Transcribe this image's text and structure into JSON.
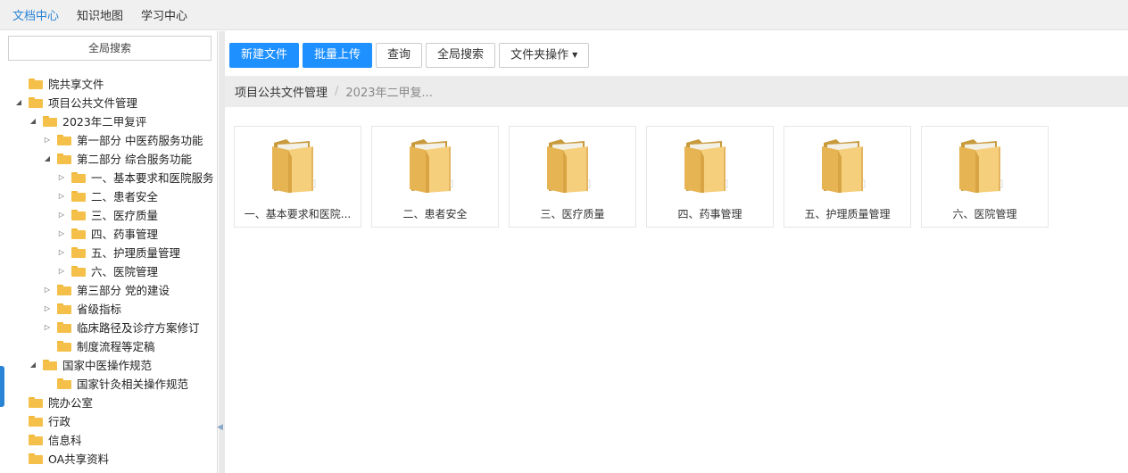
{
  "topnav": {
    "items": [
      {
        "label": "文档中心",
        "active": true
      },
      {
        "label": "知识地图",
        "active": false
      },
      {
        "label": "学习中心",
        "active": false
      }
    ]
  },
  "sidebar": {
    "search_label": "全局搜索",
    "tree": [
      {
        "label": "院共享文件",
        "level": 0,
        "toggle": "none"
      },
      {
        "label": "项目公共文件管理",
        "level": 0,
        "toggle": "open"
      },
      {
        "label": "2023年二甲复评",
        "level": 1,
        "toggle": "open"
      },
      {
        "label": "第一部分 中医药服务功能",
        "level": 2,
        "toggle": "closed"
      },
      {
        "label": "第二部分 综合服务功能",
        "level": 2,
        "toggle": "open"
      },
      {
        "label": "一、基本要求和医院服务",
        "level": 3,
        "toggle": "closed"
      },
      {
        "label": "二、患者安全",
        "level": 3,
        "toggle": "closed"
      },
      {
        "label": "三、医疗质量",
        "level": 3,
        "toggle": "closed"
      },
      {
        "label": "四、药事管理",
        "level": 3,
        "toggle": "closed"
      },
      {
        "label": "五、护理质量管理",
        "level": 3,
        "toggle": "closed"
      },
      {
        "label": "六、医院管理",
        "level": 3,
        "toggle": "closed"
      },
      {
        "label": "第三部分 党的建设",
        "level": 2,
        "toggle": "closed"
      },
      {
        "label": "省级指标",
        "level": 2,
        "toggle": "closed"
      },
      {
        "label": "临床路径及诊疗方案修订",
        "level": 2,
        "toggle": "closed"
      },
      {
        "label": "制度流程等定稿",
        "level": 2,
        "toggle": "none"
      },
      {
        "label": "国家中医操作规范",
        "level": 1,
        "toggle": "open"
      },
      {
        "label": "国家针灸相关操作规范",
        "level": 2,
        "toggle": "none"
      },
      {
        "label": "院办公室",
        "level": 0,
        "toggle": "none"
      },
      {
        "label": "行政",
        "level": 0,
        "toggle": "none"
      },
      {
        "label": "信息科",
        "level": 0,
        "toggle": "none"
      },
      {
        "label": "OA共享资料",
        "level": 0,
        "toggle": "none"
      }
    ]
  },
  "toolbar": {
    "new_file": "新建文件",
    "batch_upload": "批量上传",
    "query": "查询",
    "global_search": "全局搜索",
    "folder_ops": "文件夹操作"
  },
  "breadcrumb": {
    "items": [
      "项目公共文件管理",
      "2023年二甲复..."
    ]
  },
  "folders": [
    {
      "label": "一、基本要求和医院..."
    },
    {
      "label": "二、患者安全"
    },
    {
      "label": "三、医疗质量"
    },
    {
      "label": "四、药事管理"
    },
    {
      "label": "五、护理质量管理"
    },
    {
      "label": "六、医院管理"
    }
  ],
  "colors": {
    "accent": "#1e90ff",
    "nav_active": "#2a84d6",
    "folder": "#f5c04a"
  }
}
